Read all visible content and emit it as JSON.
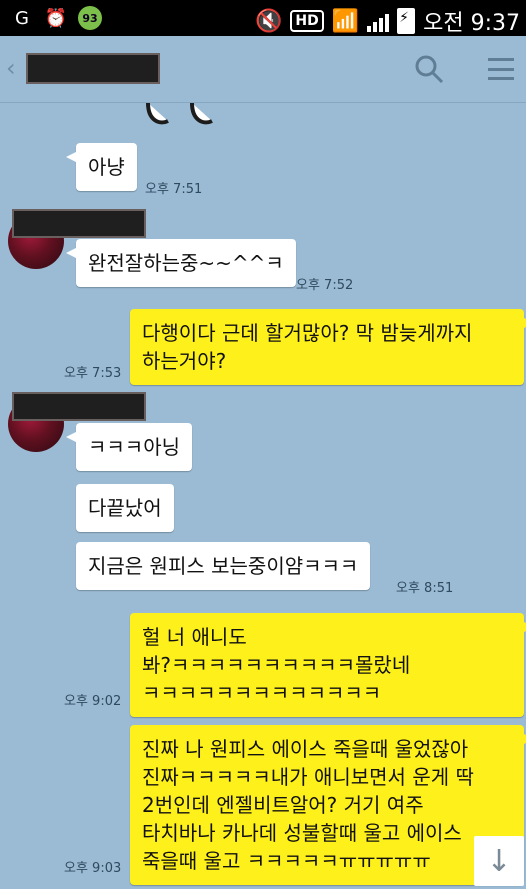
{
  "status_bar": {
    "time": "오전 9:37",
    "badge": "93",
    "network": "HD"
  },
  "appbar": {
    "back_icon": "‹"
  },
  "messages": [
    {
      "text": "아냥",
      "time": "오후 7:51"
    },
    {
      "text": "완전잘하는중~~^^ㅋ",
      "time": "오후 7:52"
    },
    {
      "text_lines": [
        "다행이다 근데 할거많아? 막 밤늦게까지",
        "하는거야?"
      ],
      "time": "오후 7:53"
    },
    {
      "text": "ㅋㅋㅋ아닝"
    },
    {
      "text": "다끝났어"
    },
    {
      "text": "지금은 원피스 보는중이얌ㅋㅋㅋ",
      "time": "오후 8:51"
    },
    {
      "text_lines": [
        "헐 너 애니도",
        "봐?ㅋㅋㅋㅋㅋㅋㅋㅋㅋㅋ몰랐네",
        "ㅋㅋㅋㅋㅋㅋㅋㅋㅋㅋㅋㅋㅋ"
      ],
      "time": "오후 9:02"
    },
    {
      "text_lines": [
        "진짜 나 원피스 에이스 죽을때 울었잖아",
        "진짜ㅋㅋㅋㅋㅋ내가 애니보면서 운게 딱",
        "2번인데 엔젤비트알어? 거기 여주",
        "타치바나 카나데 성불할때 울고 에이스",
        "죽을때 울고 ㅋㅋㅋㅋㅋㅠㅠㅠㅠㅠ"
      ],
      "time": "오후 9:03"
    }
  ],
  "scroll_icon": "↓"
}
